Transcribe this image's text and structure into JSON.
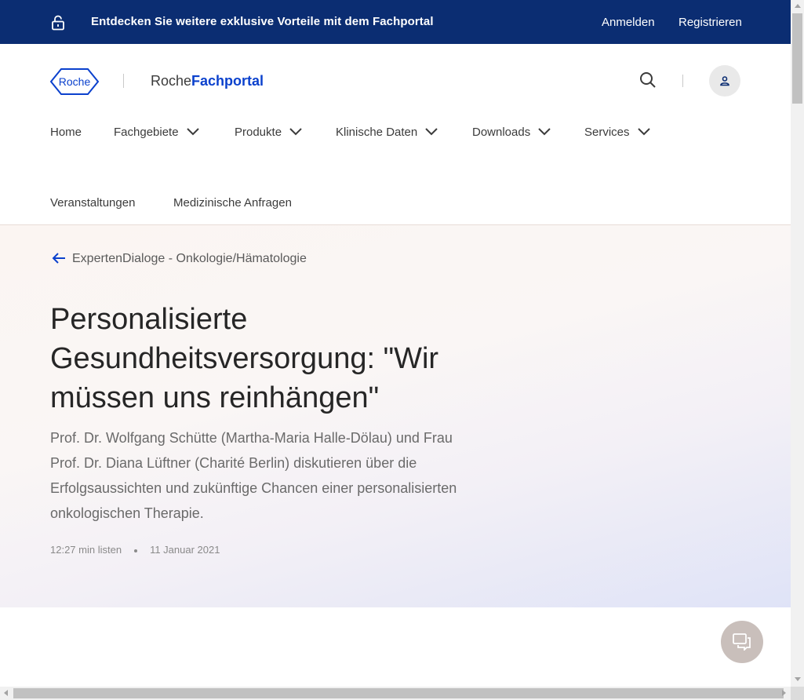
{
  "topbar": {
    "promo_text": "Entdecken Sie weitere exklusive Vorteile mit dem Fachportal",
    "login_label": "Anmelden",
    "register_label": "Registrieren"
  },
  "header": {
    "logo_text": "Roche",
    "brand_light": "Roche",
    "brand_bold": "Fachportal",
    "nav_items": [
      {
        "label": "Home"
      },
      {
        "label": "Fachgebiete"
      },
      {
        "label": "Produkte"
      },
      {
        "label": "Klinische Daten"
      },
      {
        "label": "Downloads"
      },
      {
        "label": "Services"
      },
      {
        "label": "Veranstaltungen"
      },
      {
        "label": "Medizinische Anfragen"
      }
    ]
  },
  "hero": {
    "back_label": "ExpertenDialoge - Onkologie/Hämatologie",
    "title": "Personalisierte Gesundheitsversorgung: \"Wir müssen uns reinhängen\"",
    "lead": "Prof. Dr. Wolfgang Schütte (Martha-Maria Halle-Dölau) und Frau Prof. Dr. Diana Lüftner (Charité Berlin) diskutieren über die Erfolgsaussichten und zukünftige Chancen einer personalisierten onkologischen Therapie.",
    "duration": "12:27 min listen",
    "date": "11 Januar 2021"
  },
  "icons": {
    "lock": "lock-icon",
    "search": "search-icon",
    "user": "user-icon",
    "chevron": "chevron-down-icon",
    "back": "arrow-left-icon",
    "chat": "chat-icon"
  },
  "colors": {
    "topbar_bg": "#0b2d72",
    "brand_blue": "#0b41cd",
    "hero_gradient_end": "#dfe3f7"
  }
}
